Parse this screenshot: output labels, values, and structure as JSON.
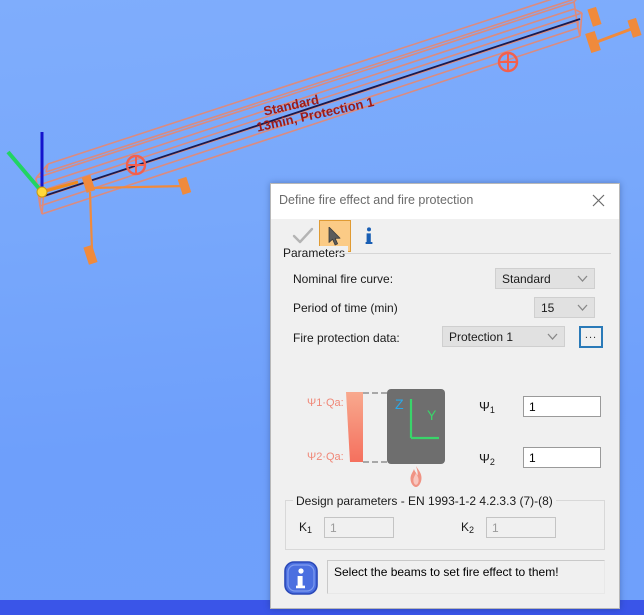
{
  "viewport": {
    "name": "3d-model-viewport",
    "annotation_line1": "Standard",
    "annotation_line2": "13min, Protection 1",
    "annotation_color": "#9c1b18",
    "background_color": "#7fadfc",
    "axis": {
      "z_color": "#1414cd",
      "x_color": "#21d463",
      "y_color": "#ef8a1e"
    },
    "beam_color": "#e88e7e",
    "centerline_color": "#1a1a4e"
  },
  "taskbar": {
    "color": "#3a55e8"
  },
  "dialog": {
    "title": "Define fire effect and fire protection",
    "close_label": "✕",
    "toolbar": {
      "ok_icon": "check-icon",
      "select_icon": "cursor-arrow-icon",
      "info_icon": "info-icon",
      "selected": "select"
    },
    "parameters": {
      "group_label": "Parameters",
      "fields": [
        {
          "label": "Nominal fire curve:",
          "value": "Standard",
          "control": "combobox"
        },
        {
          "label": "Period of time (min)",
          "value": "15",
          "control": "combobox"
        },
        {
          "label": "Fire protection data:",
          "value": "Protection 1",
          "control": "combobox"
        }
      ],
      "browse_button_label": "..."
    },
    "diagram": {
      "load_label_top": "Ψ1·Qa:",
      "load_label_bottom": "Ψ2·Qa:",
      "axis_z_label": "Z",
      "axis_y_label": "Y",
      "axis_z_color": "#2aa8e8",
      "axis_y_color": "#3ad46a",
      "flame_icon": "flame-icon",
      "section_fill": "#6e6e6e",
      "load_color": "#f08878"
    },
    "psi_inputs": [
      {
        "label": "Ψ",
        "sub": "1",
        "value": "1"
      },
      {
        "label": "Ψ",
        "sub": "2",
        "value": "1"
      }
    ],
    "design_parameters": {
      "group_label": "Design parameters - EN 1993-1-2 4.2.3.3 (7)-(8)",
      "fields": [
        {
          "label": "K",
          "sub": "1",
          "value": "1",
          "disabled": true
        },
        {
          "label": "K",
          "sub": "2",
          "value": "1",
          "disabled": true
        }
      ]
    },
    "status": {
      "icon": "info-icon",
      "message": "Select the beams to set fire effect to them!"
    }
  }
}
